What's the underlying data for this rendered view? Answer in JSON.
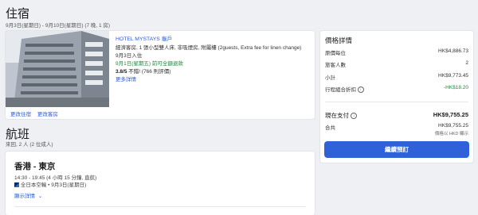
{
  "stay": {
    "title": "住宿",
    "dates": "9月3日(星期日) - 9月10日(星期日) (7 晚, 1 房)",
    "hotel_name": "HOTEL MYSTAYS 龜戶",
    "room_desc": "經濟客房, 1 張小型雙人床, 非吸煙房, 附屬樓 (2guests, Extra fee for linen change)",
    "checkin": "9月3日入住",
    "refund": "9月1日(星期五) 前可全額退款",
    "rating_score": "3.8/5",
    "rating_word": "不錯!",
    "rating_count": "(766 則評價)",
    "more_details": "更多詳情",
    "change_stay": "更改住宿",
    "change_room": "更改客房"
  },
  "flight": {
    "title": "航班",
    "subtitle": "來回, 2 人 (2 位成人)",
    "route": "香港 - 東京",
    "times": "14:30 - 19:45 (4 小時 15 分鐘, 直航)",
    "airline": "全日本空輸 • 9月3日(星期日)",
    "show_details": "顯示詳情"
  },
  "price": {
    "title": "價格詳情",
    "rows": [
      {
        "label": "原價每位",
        "value": "HK$4,886.73"
      },
      {
        "label": "旅客人數",
        "value": "2"
      },
      {
        "label": "小計",
        "value": "HK$9,773.45"
      },
      {
        "label": "行程組合折扣",
        "value": "-HK$18.20"
      }
    ],
    "pay_now_label": "現在支付",
    "pay_now_value": "HK$9,755.25",
    "total_label": "合共",
    "total_value": "HK$9,755.25",
    "currency_note": "價格以 HKD 顯示",
    "continue_button": "繼續預訂"
  },
  "colors": {
    "accent": "#2f62d8",
    "link": "#2a5bd7",
    "refund_green": "#1f8a3b",
    "discount_green": "#1f8a3b"
  }
}
